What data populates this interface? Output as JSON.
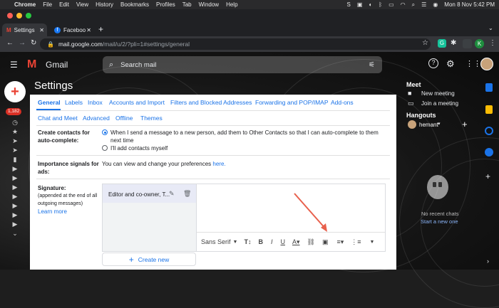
{
  "macbar": {
    "app": "Chrome",
    "menus": [
      "File",
      "Edit",
      "View",
      "History",
      "Bookmarks",
      "Profiles",
      "Tab",
      "Window",
      "Help"
    ],
    "datetime": "Mon 8 Nov  5:42 PM"
  },
  "tabs": [
    {
      "label": "Settings"
    },
    {
      "label": "Faceboo"
    }
  ],
  "address": {
    "host": "mail.google.com",
    "path": "/mail/u/2/?pli=1#settings/general"
  },
  "gmail": {
    "logo_text": "Gmail",
    "search_placeholder": "Search mail",
    "unread_badge": "1,182",
    "page_title": "Settings"
  },
  "settings_tabs_row1": [
    "General",
    "Labels",
    "Inbox",
    "Accounts and Import",
    "Filters and Blocked Addresses",
    "Forwarding and POP/IMAP",
    "Add-ons"
  ],
  "settings_tabs_row2": [
    "Chat and Meet",
    "Advanced",
    "Offline",
    "Themes"
  ],
  "create_contacts": {
    "label": "Create contacts for auto-complete:",
    "option1": "When I send a message to a new person, add them to Other Contacts so that I can auto-complete to them next time",
    "option2": "I'll add contacts myself",
    "selected": 1
  },
  "importance": {
    "label": "Importance signals for ads:",
    "text": "You can view and change your preferences ",
    "link": "here."
  },
  "signature": {
    "label": "Signature:",
    "hint": "(appended at the end of all outgoing messages)",
    "learn_more": "Learn more",
    "item": "Editor and co-owner, T...",
    "font": "Sans Serif",
    "create_new": "Create new"
  },
  "right_panel": {
    "meet_title": "Meet",
    "new_meeting": "New meeting",
    "join_meeting": "Join a meeting",
    "hangouts_title": "Hangouts",
    "user": "hemant",
    "no_chats": "No recent chats",
    "start_new": "Start a new one"
  },
  "colors": {
    "accent": "#1a73e8",
    "gmail_red": "#ea4335",
    "annotation_arrow": "#e8604c"
  }
}
